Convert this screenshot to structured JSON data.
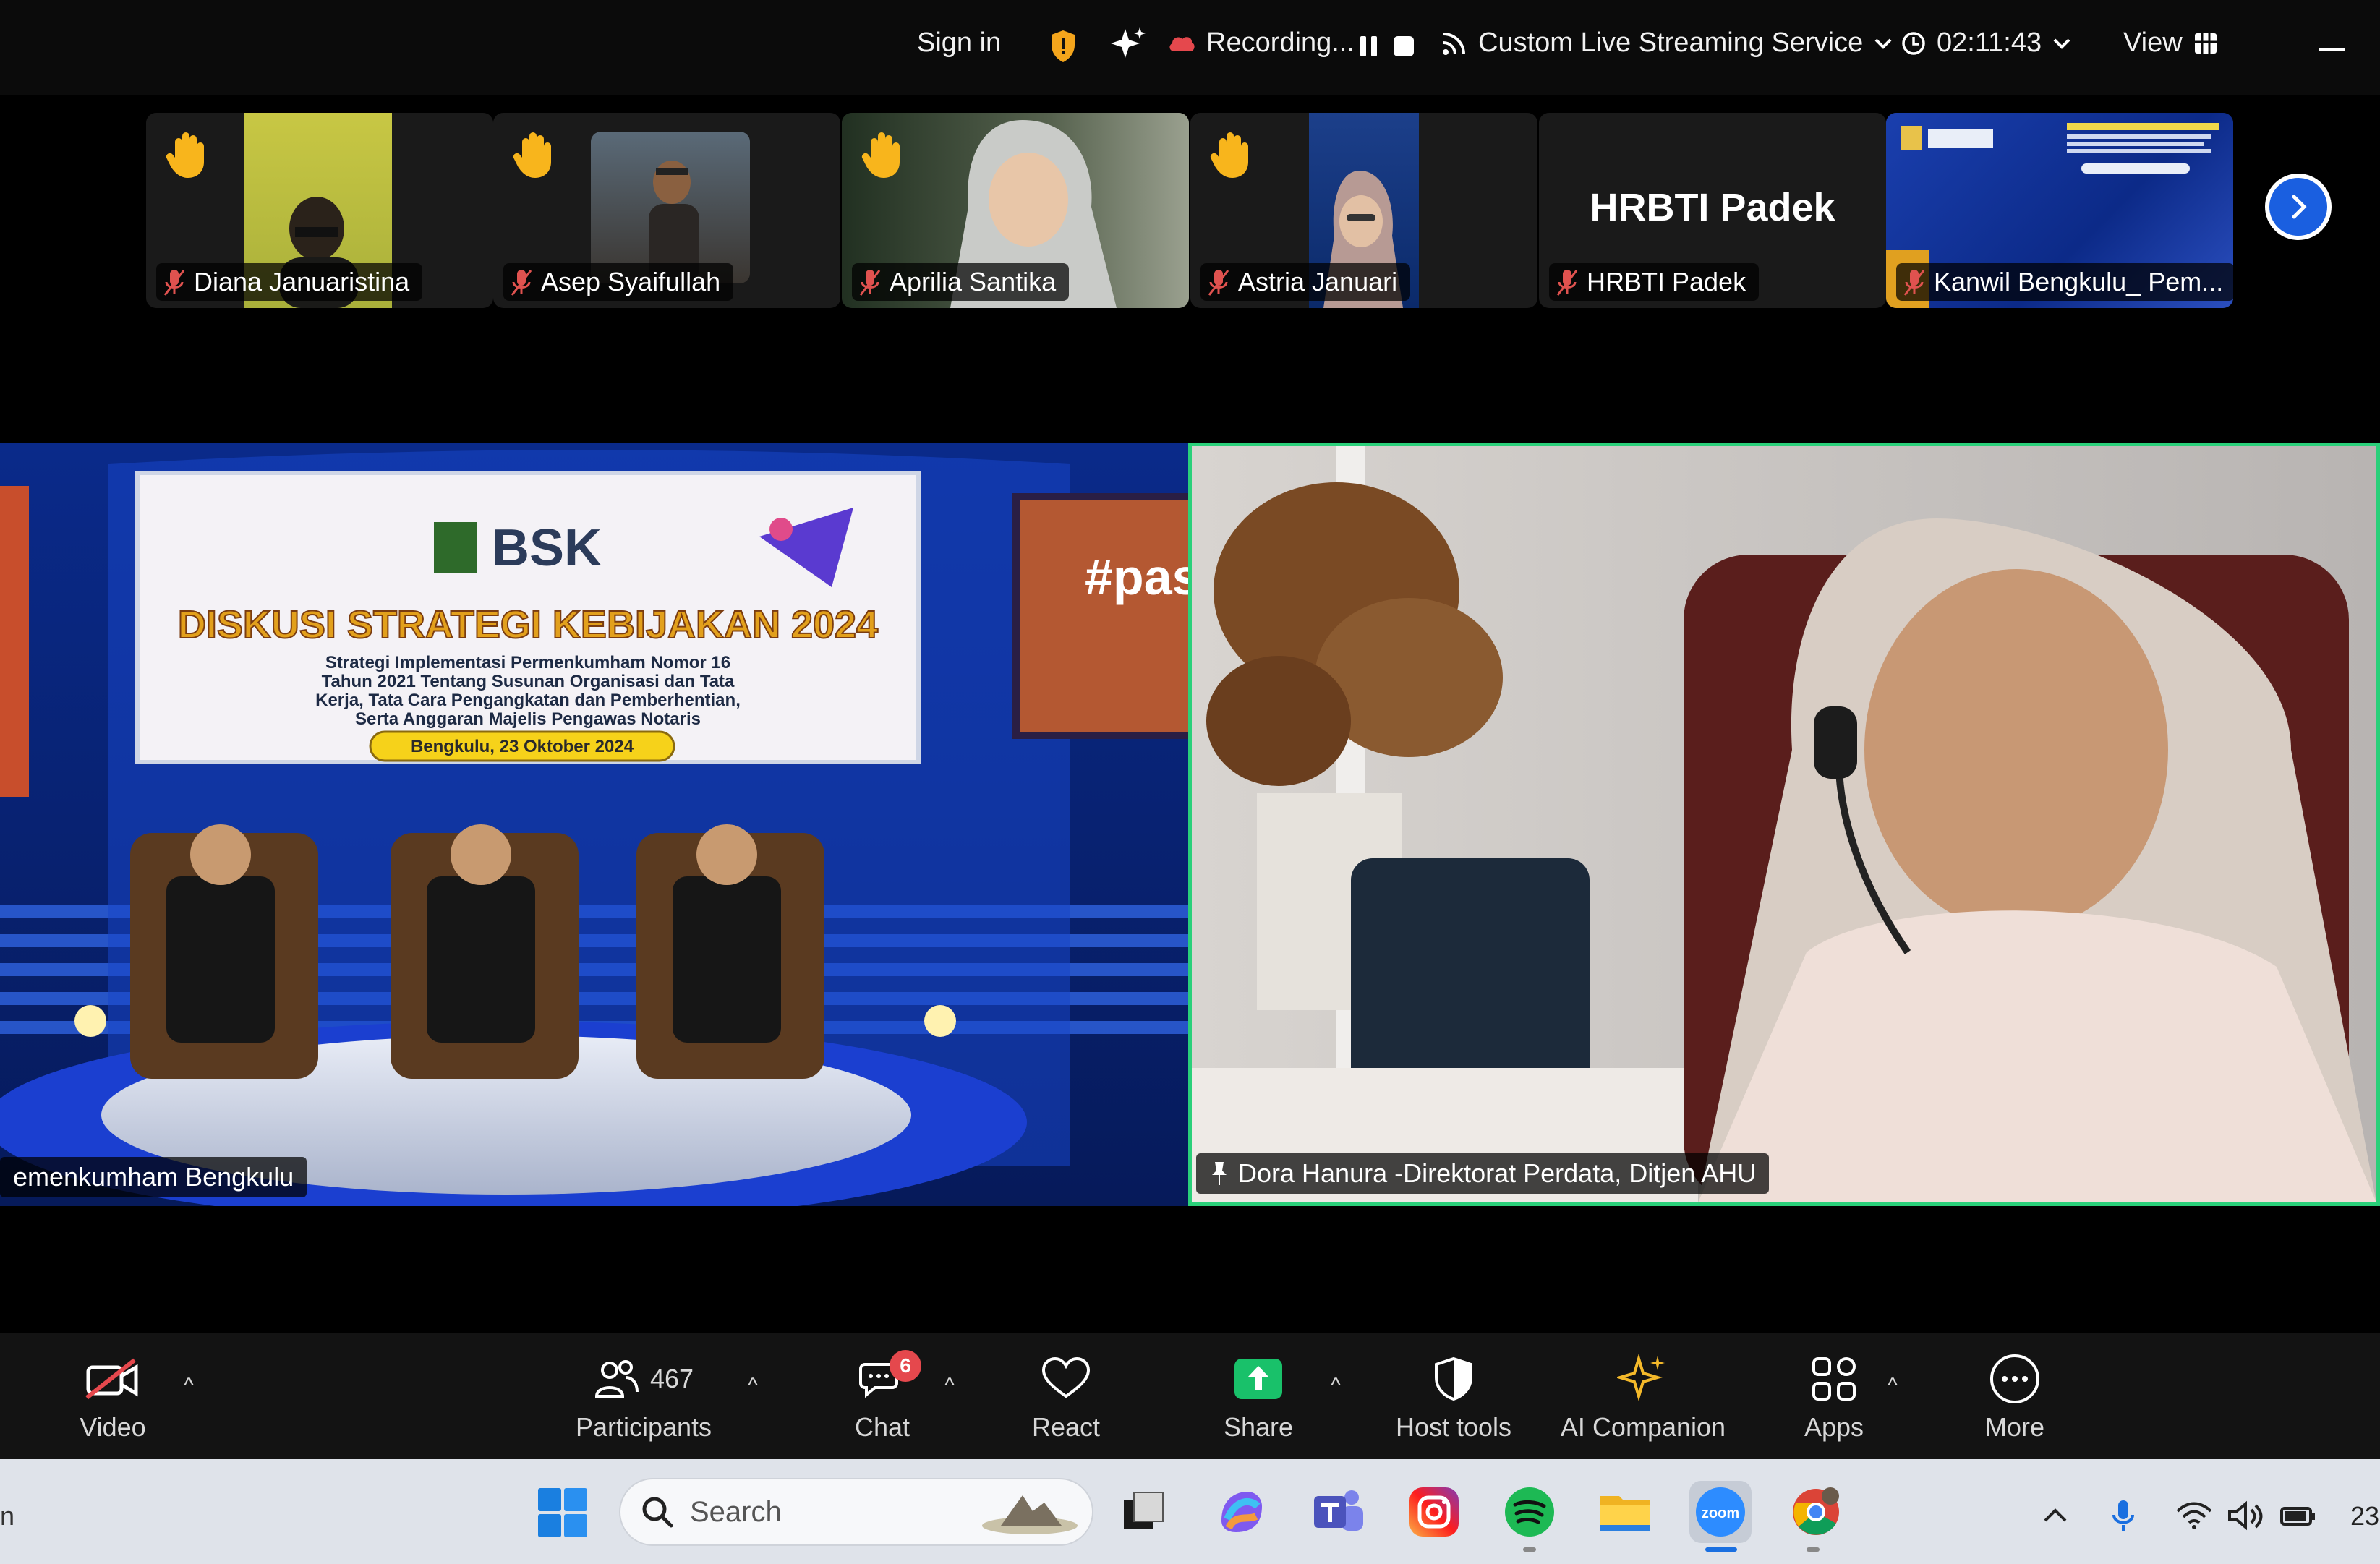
{
  "topbar": {
    "sign_in": "Sign in",
    "recording_label": "Recording...",
    "streaming_label": "Custom Live Streaming Service",
    "timer": "02:11:43",
    "view_label": "View"
  },
  "thumbnails": [
    {
      "name": "Diana Januaristina",
      "hand_raised": true,
      "muted": true
    },
    {
      "name": "Asep Syaifullah",
      "hand_raised": true,
      "muted": true
    },
    {
      "name": "Aprilia Santika",
      "hand_raised": true,
      "muted": true
    },
    {
      "name": "Astria Januari",
      "hand_raised": true,
      "muted": true
    },
    {
      "name": "HRBTI Padek",
      "display_text": "HRBTI Padek",
      "hand_raised": false,
      "muted": true
    },
    {
      "name": "Kanwil Bengkulu_ Pem...",
      "hand_raised": false,
      "muted": true
    }
  ],
  "main": {
    "left_tile": {
      "label": "emenkumham Bengkulu",
      "banner_logo": "BSK",
      "banner_title": "DISKUSI STRATEGI KEBIJAKAN 2024",
      "banner_subtitle_lines": [
        "Strategi Implementasi Permenkumham Nomor 16",
        "Tahun 2021 Tentang Susunan Organisasi dan Tata",
        "Kerja, Tata Cara Pengangkatan dan Pemberhentian,",
        "Serta Anggaran Majelis Pengawas Notaris"
      ],
      "banner_date": "Bengkulu, 23 Oktober 2024",
      "side_screen_text": "#pasti PA"
    },
    "right_tile": {
      "label": "Dora Hanura -Direktorat Perdata, Ditjen AHU",
      "active_speaker": true
    }
  },
  "toolbar": {
    "video": "Video",
    "participants": "Participants",
    "participants_count": "467",
    "chat": "Chat",
    "chat_badge": "6",
    "react": "React",
    "share": "Share",
    "host_tools": "Host tools",
    "ai_companion": "AI Companion",
    "apps": "Apps",
    "more": "More"
  },
  "taskbar": {
    "search_placeholder": "Search",
    "clock_partial": "23",
    "left_edge_partial": "n"
  },
  "colors": {
    "active_speaker_border": "#2ad07a",
    "share_green": "#19c16a",
    "badge_red": "#e5484d",
    "next_button_blue": "#1a5fe0",
    "muted_red": "#e0524f"
  }
}
